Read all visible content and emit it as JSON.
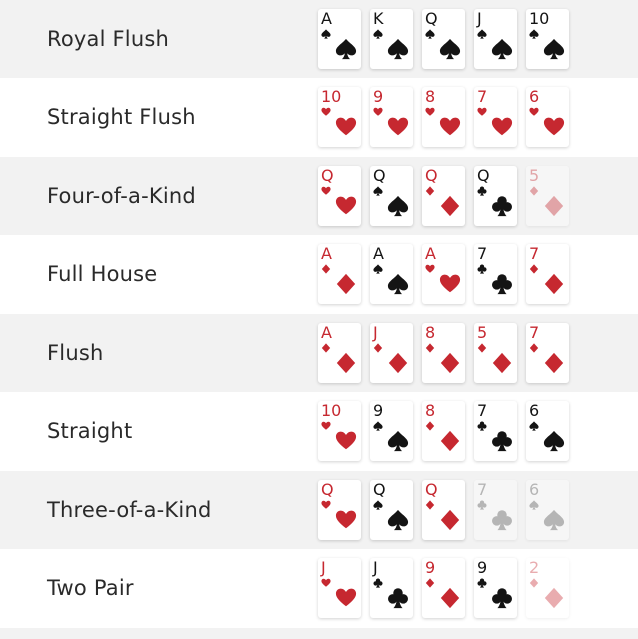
{
  "colors": {
    "red": "#c62830",
    "black": "#141414",
    "row_shaded": "#f2f2f2"
  },
  "hands": [
    {
      "name": "Royal Flush",
      "cards": [
        {
          "rank": "A",
          "suit": "spade"
        },
        {
          "rank": "K",
          "suit": "spade"
        },
        {
          "rank": "Q",
          "suit": "spade"
        },
        {
          "rank": "J",
          "suit": "spade"
        },
        {
          "rank": "10",
          "suit": "spade"
        }
      ]
    },
    {
      "name": "Straight Flush",
      "cards": [
        {
          "rank": "10",
          "suit": "heart"
        },
        {
          "rank": "9",
          "suit": "heart"
        },
        {
          "rank": "8",
          "suit": "heart"
        },
        {
          "rank": "7",
          "suit": "heart"
        },
        {
          "rank": "6",
          "suit": "heart"
        }
      ]
    },
    {
      "name": "Four-of-a-Kind",
      "cards": [
        {
          "rank": "Q",
          "suit": "heart"
        },
        {
          "rank": "Q",
          "suit": "spade"
        },
        {
          "rank": "Q",
          "suit": "diamond"
        },
        {
          "rank": "Q",
          "suit": "club"
        },
        {
          "rank": "5",
          "suit": "diamond",
          "faded": true
        }
      ]
    },
    {
      "name": "Full House",
      "cards": [
        {
          "rank": "A",
          "suit": "diamond"
        },
        {
          "rank": "A",
          "suit": "spade"
        },
        {
          "rank": "A",
          "suit": "heart"
        },
        {
          "rank": "7",
          "suit": "club"
        },
        {
          "rank": "7",
          "suit": "diamond"
        }
      ]
    },
    {
      "name": "Flush",
      "cards": [
        {
          "rank": "A",
          "suit": "diamond"
        },
        {
          "rank": "J",
          "suit": "diamond"
        },
        {
          "rank": "8",
          "suit": "diamond"
        },
        {
          "rank": "5",
          "suit": "diamond"
        },
        {
          "rank": "7",
          "suit": "diamond"
        }
      ]
    },
    {
      "name": "Straight",
      "cards": [
        {
          "rank": "10",
          "suit": "heart"
        },
        {
          "rank": "9",
          "suit": "spade"
        },
        {
          "rank": "8",
          "suit": "diamond"
        },
        {
          "rank": "7",
          "suit": "club"
        },
        {
          "rank": "6",
          "suit": "spade"
        }
      ]
    },
    {
      "name": "Three-of-a-Kind",
      "cards": [
        {
          "rank": "Q",
          "suit": "heart"
        },
        {
          "rank": "Q",
          "suit": "spade"
        },
        {
          "rank": "Q",
          "suit": "diamond"
        },
        {
          "rank": "7",
          "suit": "club",
          "faded": true
        },
        {
          "rank": "6",
          "suit": "spade",
          "faded": true
        }
      ]
    },
    {
      "name": "Two Pair",
      "cards": [
        {
          "rank": "J",
          "suit": "heart"
        },
        {
          "rank": "J",
          "suit": "club"
        },
        {
          "rank": "9",
          "suit": "diamond"
        },
        {
          "rank": "9",
          "suit": "club"
        },
        {
          "rank": "2",
          "suit": "diamond",
          "faded": true
        }
      ]
    }
  ]
}
